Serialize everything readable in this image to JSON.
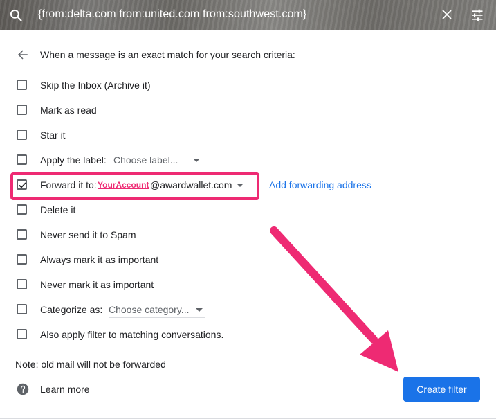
{
  "search": {
    "query": "{from:delta.com from:united.com from:southwest.com}",
    "icons": {
      "search": "search-icon",
      "close": "close-icon",
      "options": "tune-icon"
    }
  },
  "filter": {
    "heading": "When a message is an exact match for your search criteria:",
    "options": [
      {
        "label": "Skip the Inbox (Archive it)",
        "checked": false
      },
      {
        "label": "Mark as read",
        "checked": false
      },
      {
        "label": "Star it",
        "checked": false
      },
      {
        "label": "Apply the label:",
        "checked": false,
        "select": "Choose label..."
      },
      {
        "label": "Forward it to:",
        "checked": true
      },
      {
        "label": "Delete it",
        "checked": false
      },
      {
        "label": "Never send it to Spam",
        "checked": false
      },
      {
        "label": "Always mark it as important",
        "checked": false
      },
      {
        "label": "Never mark it as important",
        "checked": false
      },
      {
        "label": "Categorize as:",
        "checked": false,
        "select": "Choose category..."
      },
      {
        "label": "Also apply filter to matching conversations.",
        "checked": false
      }
    ],
    "forward": {
      "account": "YourAccount",
      "domain": "@awardwallet.com",
      "add_link": "Add forwarding address"
    },
    "note": "Note: old mail will not be forwarded",
    "learn_more": "Learn more",
    "create_button": "Create filter"
  },
  "colors": {
    "accent": "#1a73e8",
    "highlight": "#ee2a73"
  }
}
